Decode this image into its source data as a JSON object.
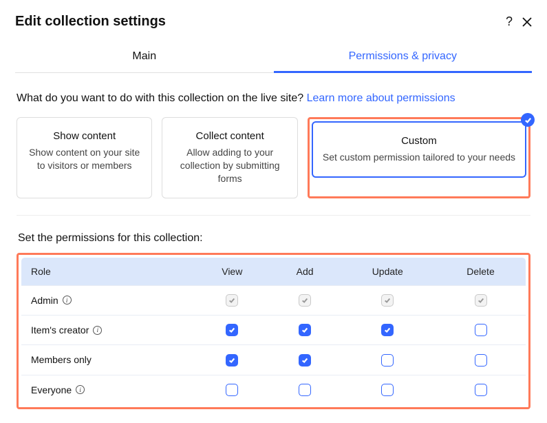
{
  "header": {
    "title": "Edit collection settings"
  },
  "tabs": {
    "main": "Main",
    "permissions": "Permissions & privacy"
  },
  "prompt": {
    "question": "What do you want to do with this collection on the live site? ",
    "link": "Learn more about permissions"
  },
  "cards": {
    "show": {
      "title": "Show content",
      "desc": "Show content on your site to visitors or members"
    },
    "collect": {
      "title": "Collect content",
      "desc": "Allow adding to your collection by submitting forms"
    },
    "custom": {
      "title": "Custom",
      "desc": "Set custom permission tailored to your needs"
    }
  },
  "subheading": "Set the permissions for this collection:",
  "table": {
    "headers": {
      "role": "Role",
      "view": "View",
      "add": "Add",
      "update": "Update",
      "delete": "Delete"
    },
    "rows": [
      {
        "role": "Admin",
        "info": true,
        "view": "locked",
        "add": "locked",
        "update": "locked",
        "delete": "locked"
      },
      {
        "role": "Item's creator",
        "info": true,
        "view": "checked",
        "add": "checked",
        "update": "checked",
        "delete": "empty"
      },
      {
        "role": "Members only",
        "info": false,
        "view": "checked",
        "add": "checked",
        "update": "empty",
        "delete": "empty"
      },
      {
        "role": "Everyone",
        "info": true,
        "view": "empty",
        "add": "empty",
        "update": "empty",
        "delete": "empty"
      }
    ]
  }
}
